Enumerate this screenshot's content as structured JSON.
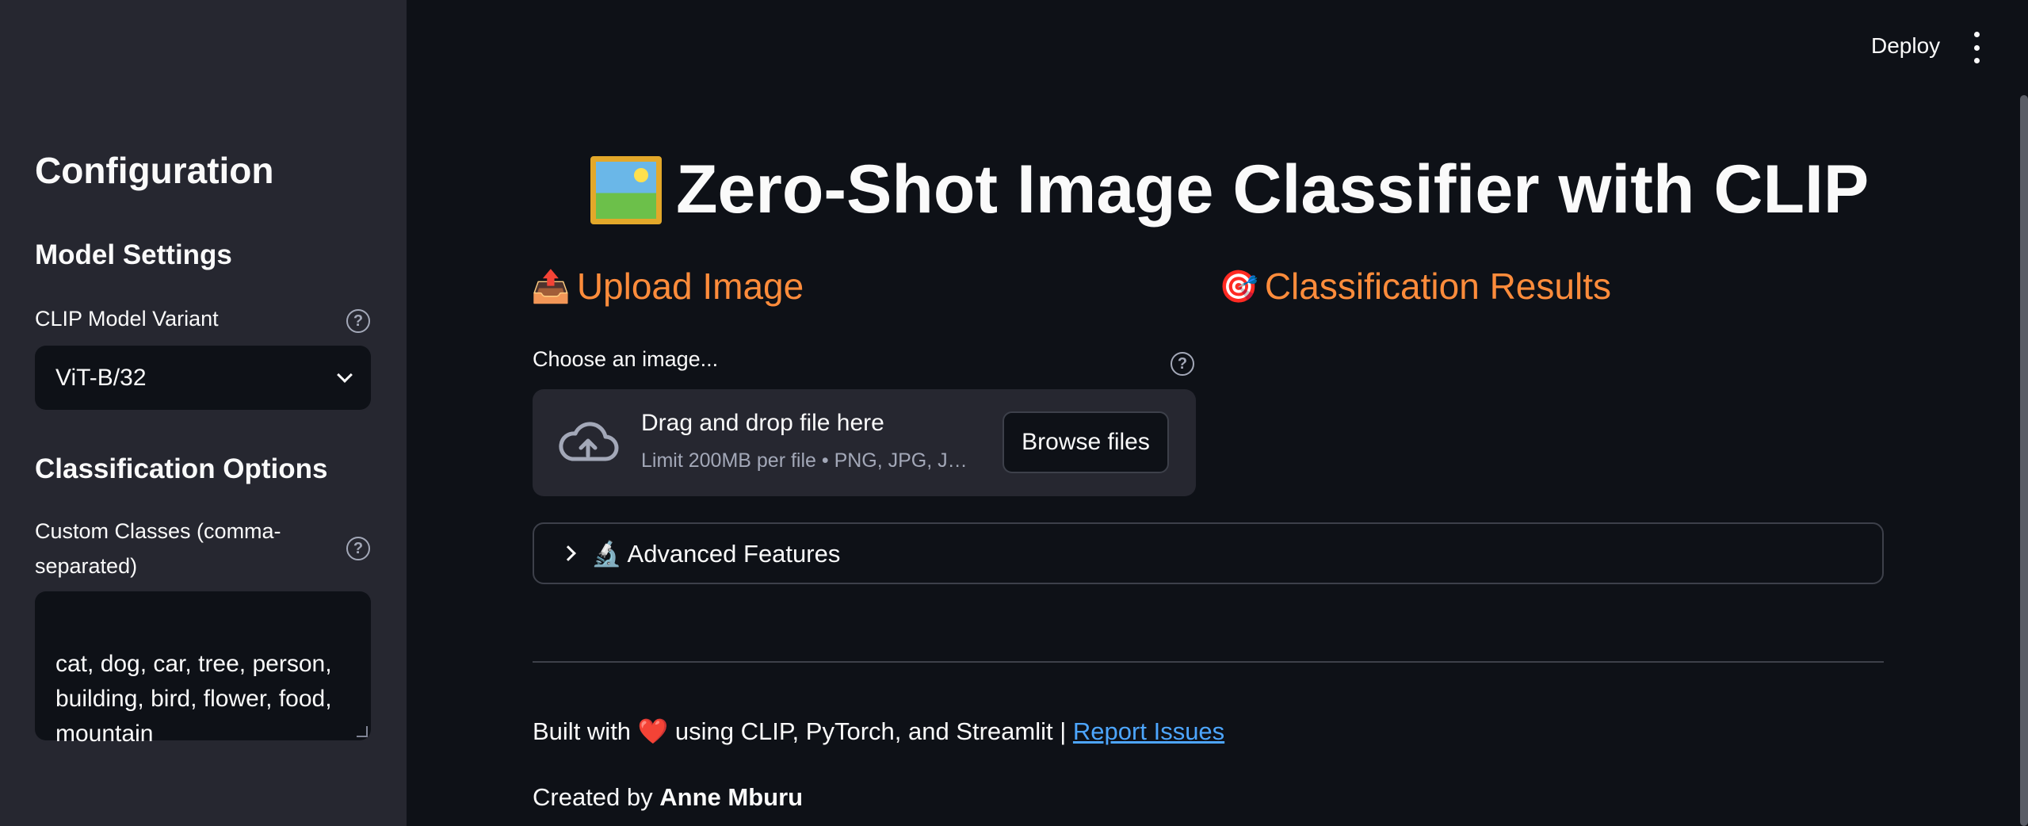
{
  "header": {
    "deploy_label": "Deploy",
    "menu_icon": "kebab-menu-icon"
  },
  "sidebar": {
    "title": "Configuration",
    "model_settings": {
      "heading": "Model Settings",
      "variant_label": "CLIP Model Variant",
      "variant_value": "ViT-B/32"
    },
    "classification_options": {
      "heading": "Classification Options",
      "custom_classes_label": "Custom Classes (comma-separated)",
      "custom_classes_value": "cat, dog, car, tree, person, building, bird, flower, food, mountain"
    }
  },
  "main": {
    "title": "Zero-Shot Image Classifier with CLIP",
    "upload_heading": "Upload Image",
    "results_heading": "Classification Results",
    "uploader": {
      "label": "Choose an image...",
      "drop_title": "Drag and drop file here",
      "drop_subtitle": "Limit 200MB per file • PNG, JPG, J…",
      "browse_label": "Browse files"
    },
    "advanced_label": "Advanced Features",
    "footer": {
      "built_prefix": "Built with",
      "heart": "❤️",
      "built_suffix": "using CLIP, PyTorch, and Streamlit |",
      "report_link": "Report Issues",
      "created_prefix": "Created by",
      "author": "Anne Mburu"
    }
  },
  "colors": {
    "background": "#0e1117",
    "sidebar": "#262730",
    "accent_heading": "#ff8c3b",
    "link": "#4da6ff"
  }
}
